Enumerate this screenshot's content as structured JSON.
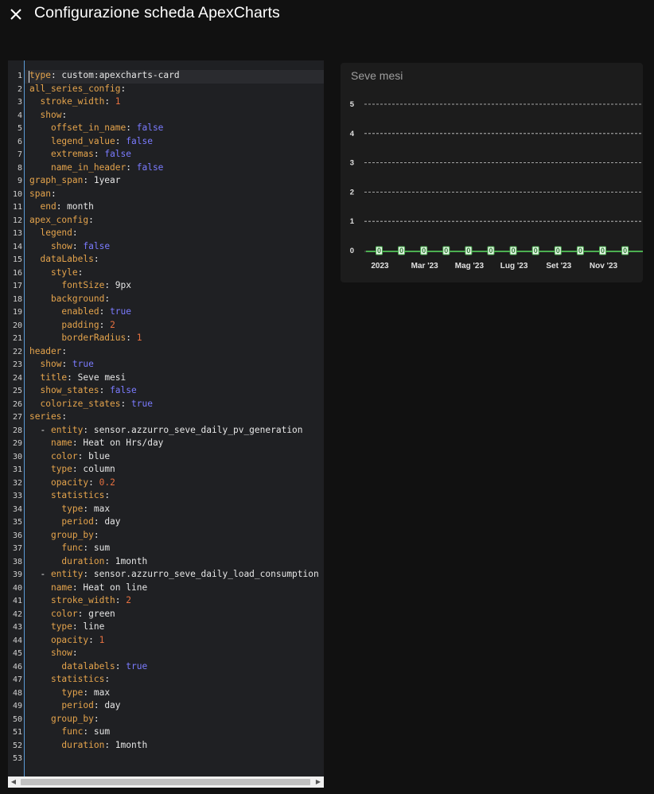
{
  "dialog": {
    "title": "Configurazione scheda ApexCharts",
    "close_icon": "close-icon"
  },
  "editor": {
    "lines": [
      [
        [
          "k",
          "type"
        ],
        [
          "s",
          ": custom:apexcharts-card"
        ]
      ],
      [
        [
          "k",
          "all_series_config"
        ],
        [
          "s",
          ":"
        ]
      ],
      [
        [
          "s",
          "  "
        ],
        [
          "k",
          "stroke_width"
        ],
        [
          "s",
          ": "
        ],
        [
          "n",
          "1"
        ]
      ],
      [
        [
          "s",
          "  "
        ],
        [
          "k",
          "show"
        ],
        [
          "s",
          ":"
        ]
      ],
      [
        [
          "s",
          "    "
        ],
        [
          "k",
          "offset_in_name"
        ],
        [
          "s",
          ": "
        ],
        [
          "b",
          "false"
        ]
      ],
      [
        [
          "s",
          "    "
        ],
        [
          "k",
          "legend_value"
        ],
        [
          "s",
          ": "
        ],
        [
          "b",
          "false"
        ]
      ],
      [
        [
          "s",
          "    "
        ],
        [
          "k",
          "extremas"
        ],
        [
          "s",
          ": "
        ],
        [
          "b",
          "false"
        ]
      ],
      [
        [
          "s",
          "    "
        ],
        [
          "k",
          "name_in_header"
        ],
        [
          "s",
          ": "
        ],
        [
          "b",
          "false"
        ]
      ],
      [
        [
          "k",
          "graph_span"
        ],
        [
          "s",
          ": 1year"
        ]
      ],
      [
        [
          "k",
          "span"
        ],
        [
          "s",
          ":"
        ]
      ],
      [
        [
          "s",
          "  "
        ],
        [
          "k",
          "end"
        ],
        [
          "s",
          ": month"
        ]
      ],
      [
        [
          "k",
          "apex_config"
        ],
        [
          "s",
          ":"
        ]
      ],
      [
        [
          "s",
          "  "
        ],
        [
          "k",
          "legend"
        ],
        [
          "s",
          ":"
        ]
      ],
      [
        [
          "s",
          "    "
        ],
        [
          "k",
          "show"
        ],
        [
          "s",
          ": "
        ],
        [
          "b",
          "false"
        ]
      ],
      [
        [
          "s",
          "  "
        ],
        [
          "k",
          "dataLabels"
        ],
        [
          "s",
          ":"
        ]
      ],
      [
        [
          "s",
          "    "
        ],
        [
          "k",
          "style"
        ],
        [
          "s",
          ":"
        ]
      ],
      [
        [
          "s",
          "      "
        ],
        [
          "k",
          "fontSize"
        ],
        [
          "s",
          ": 9px"
        ]
      ],
      [
        [
          "s",
          "    "
        ],
        [
          "k",
          "background"
        ],
        [
          "s",
          ":"
        ]
      ],
      [
        [
          "s",
          "      "
        ],
        [
          "k",
          "enabled"
        ],
        [
          "s",
          ": "
        ],
        [
          "b",
          "true"
        ]
      ],
      [
        [
          "s",
          "      "
        ],
        [
          "k",
          "padding"
        ],
        [
          "s",
          ": "
        ],
        [
          "n",
          "2"
        ]
      ],
      [
        [
          "s",
          "      "
        ],
        [
          "k",
          "borderRadius"
        ],
        [
          "s",
          ": "
        ],
        [
          "n",
          "1"
        ]
      ],
      [
        [
          "k",
          "header"
        ],
        [
          "s",
          ":"
        ]
      ],
      [
        [
          "s",
          "  "
        ],
        [
          "k",
          "show"
        ],
        [
          "s",
          ": "
        ],
        [
          "b",
          "true"
        ]
      ],
      [
        [
          "s",
          "  "
        ],
        [
          "k",
          "title"
        ],
        [
          "s",
          ": Seve mesi"
        ]
      ],
      [
        [
          "s",
          "  "
        ],
        [
          "k",
          "show_states"
        ],
        [
          "s",
          ": "
        ],
        [
          "b",
          "false"
        ]
      ],
      [
        [
          "s",
          "  "
        ],
        [
          "k",
          "colorize_states"
        ],
        [
          "s",
          ": "
        ],
        [
          "b",
          "true"
        ]
      ],
      [
        [
          "k",
          "series"
        ],
        [
          "s",
          ":"
        ]
      ],
      [
        [
          "s",
          "  - "
        ],
        [
          "k",
          "entity"
        ],
        [
          "s",
          ": sensor.azzurro_seve_daily_pv_generation"
        ]
      ],
      [
        [
          "s",
          "    "
        ],
        [
          "k",
          "name"
        ],
        [
          "s",
          ": Heat on Hrs/day"
        ]
      ],
      [
        [
          "s",
          "    "
        ],
        [
          "k",
          "color"
        ],
        [
          "s",
          ": blue"
        ]
      ],
      [
        [
          "s",
          "    "
        ],
        [
          "k",
          "type"
        ],
        [
          "s",
          ": column"
        ]
      ],
      [
        [
          "s",
          "    "
        ],
        [
          "k",
          "opacity"
        ],
        [
          "s",
          ": "
        ],
        [
          "n",
          "0.2"
        ]
      ],
      [
        [
          "s",
          "    "
        ],
        [
          "k",
          "statistics"
        ],
        [
          "s",
          ":"
        ]
      ],
      [
        [
          "s",
          "      "
        ],
        [
          "k",
          "type"
        ],
        [
          "s",
          ": max"
        ]
      ],
      [
        [
          "s",
          "      "
        ],
        [
          "k",
          "period"
        ],
        [
          "s",
          ": day"
        ]
      ],
      [
        [
          "s",
          "    "
        ],
        [
          "k",
          "group_by"
        ],
        [
          "s",
          ":"
        ]
      ],
      [
        [
          "s",
          "      "
        ],
        [
          "k",
          "func"
        ],
        [
          "s",
          ": sum"
        ]
      ],
      [
        [
          "s",
          "      "
        ],
        [
          "k",
          "duration"
        ],
        [
          "s",
          ": 1month"
        ]
      ],
      [
        [
          "s",
          "  - "
        ],
        [
          "k",
          "entity"
        ],
        [
          "s",
          ": sensor.azzurro_seve_daily_load_consumption"
        ]
      ],
      [
        [
          "s",
          "    "
        ],
        [
          "k",
          "name"
        ],
        [
          "s",
          ": Heat on line"
        ]
      ],
      [
        [
          "s",
          "    "
        ],
        [
          "k",
          "stroke_width"
        ],
        [
          "s",
          ": "
        ],
        [
          "n",
          "2"
        ]
      ],
      [
        [
          "s",
          "    "
        ],
        [
          "k",
          "color"
        ],
        [
          "s",
          ": green"
        ]
      ],
      [
        [
          "s",
          "    "
        ],
        [
          "k",
          "type"
        ],
        [
          "s",
          ": line"
        ]
      ],
      [
        [
          "s",
          "    "
        ],
        [
          "k",
          "opacity"
        ],
        [
          "s",
          ": "
        ],
        [
          "n",
          "1"
        ]
      ],
      [
        [
          "s",
          "    "
        ],
        [
          "k",
          "show"
        ],
        [
          "s",
          ":"
        ]
      ],
      [
        [
          "s",
          "      "
        ],
        [
          "k",
          "datalabels"
        ],
        [
          "s",
          ": "
        ],
        [
          "b",
          "true"
        ]
      ],
      [
        [
          "s",
          "    "
        ],
        [
          "k",
          "statistics"
        ],
        [
          "s",
          ":"
        ]
      ],
      [
        [
          "s",
          "      "
        ],
        [
          "k",
          "type"
        ],
        [
          "s",
          ": max"
        ]
      ],
      [
        [
          "s",
          "      "
        ],
        [
          "k",
          "period"
        ],
        [
          "s",
          ": day"
        ]
      ],
      [
        [
          "s",
          "    "
        ],
        [
          "k",
          "group_by"
        ],
        [
          "s",
          ":"
        ]
      ],
      [
        [
          "s",
          "      "
        ],
        [
          "k",
          "func"
        ],
        [
          "s",
          ": sum"
        ]
      ],
      [
        [
          "s",
          "      "
        ],
        [
          "k",
          "duration"
        ],
        [
          "s",
          ": 1month"
        ]
      ],
      []
    ],
    "syntax_colors": {
      "key": "#e5a44c",
      "boolean": "#7b7bff",
      "number": "#e57040",
      "plain": "#e6e6e6",
      "gutter_border": "#5b9bd5"
    }
  },
  "preview_card": {
    "title": "Seve mesi"
  },
  "chart_data": {
    "type": "line",
    "title": "Seve mesi",
    "xlabel": "",
    "ylabel": "",
    "ylim": [
      0,
      5
    ],
    "y_ticks": [
      "0",
      "1",
      "2",
      "3",
      "4",
      "5"
    ],
    "x_tick_labels": [
      "2023",
      "Mar '23",
      "Mag '23",
      "Lug '23",
      "Set '23",
      "Nov '23"
    ],
    "grid": "horizontal dashed",
    "legend": "none",
    "series": [
      {
        "type": "line",
        "color": "#4caf50",
        "x": [
          "Gen '23",
          "Feb '23",
          "Mar '23",
          "Apr '23",
          "Mag '23",
          "Giu '23",
          "Lug '23",
          "Ago '23",
          "Set '23",
          "Ott '23",
          "Nov '23",
          "Dic '23"
        ],
        "values": [
          0,
          0,
          0,
          0,
          0,
          0,
          0,
          0,
          0,
          0,
          0,
          0
        ],
        "data_labels": [
          "0",
          "0",
          "0",
          "0",
          "0",
          "0",
          "0",
          "0",
          "0",
          "0",
          "0",
          "0"
        ]
      },
      {
        "type": "column",
        "color": "#0000ff",
        "opacity": 0.2,
        "values": [
          0,
          0,
          0,
          0,
          0,
          0,
          0,
          0,
          0,
          0,
          0,
          0
        ]
      }
    ]
  }
}
